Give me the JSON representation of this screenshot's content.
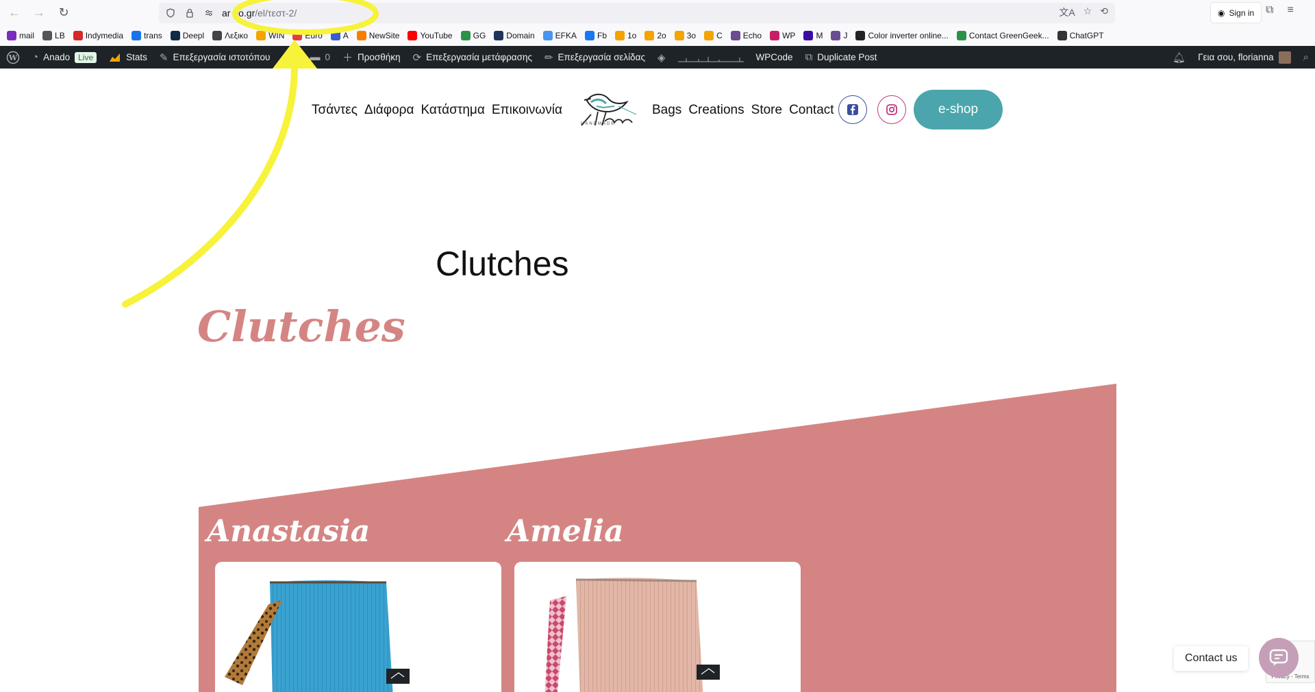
{
  "browser": {
    "url_host": "ar  do.gr",
    "url_path": "/el/τεστ-2/",
    "signin_label": "Sign in"
  },
  "bookmarks": [
    {
      "label": "mail",
      "icon": "mail-icon",
      "color": "#7b2cbf"
    },
    {
      "label": "LB",
      "icon": "lb-icon",
      "color": "#555555"
    },
    {
      "label": "Indymedia",
      "icon": "indymedia-icon",
      "color": "#d62828"
    },
    {
      "label": "trans",
      "icon": "translate-icon",
      "color": "#1a73e8"
    },
    {
      "label": "Deepl",
      "icon": "deepl-icon",
      "color": "#0f2b46"
    },
    {
      "label": "Λεξικο",
      "icon": "dictionary-icon",
      "color": "#444444"
    },
    {
      "label": "WIN",
      "icon": "win-icon",
      "color": "#f4a300"
    },
    {
      "label": "Euro",
      "icon": "euro-icon",
      "color": "#e63946"
    },
    {
      "label": "A",
      "icon": "a-icon",
      "color": "#3a5ccc"
    },
    {
      "label": "NewSite",
      "icon": "newsite-icon",
      "color": "#f77f00"
    },
    {
      "label": "YouTube",
      "icon": "youtube-icon",
      "color": "#ff0000"
    },
    {
      "label": "GG",
      "icon": "gg-icon",
      "color": "#2b9348"
    },
    {
      "label": "Domain",
      "icon": "domain-icon",
      "color": "#1d3557"
    },
    {
      "label": "EFKA",
      "icon": "efka-icon",
      "color": "#4895ef"
    },
    {
      "label": "Fb",
      "icon": "facebook-icon",
      "color": "#1877f2"
    },
    {
      "label": "1o",
      "icon": "rss-icon",
      "color": "#f4a300"
    },
    {
      "label": "2o",
      "icon": "rss-icon",
      "color": "#f4a300"
    },
    {
      "label": "3o",
      "icon": "rss-icon",
      "color": "#f4a300"
    },
    {
      "label": "C",
      "icon": "rss-icon",
      "color": "#f4a300"
    },
    {
      "label": "Echo",
      "icon": "echo-icon",
      "color": "#6a4c93"
    },
    {
      "label": "WP",
      "icon": "wp-icon",
      "color": "#c71f66"
    },
    {
      "label": "M",
      "icon": "m-icon",
      "color": "#3a0ca3"
    },
    {
      "label": "J",
      "icon": "j-icon",
      "color": "#6a4c93"
    },
    {
      "label": "Color inverter online...",
      "icon": "color-inverter-icon",
      "color": "#222222"
    },
    {
      "label": "Contact GreenGeek...",
      "icon": "greengeek-icon",
      "color": "#2b9348"
    },
    {
      "label": "ChatGPT",
      "icon": "chatgpt-icon",
      "color": "#333333"
    }
  ],
  "adminbar": {
    "site": "Anado",
    "live": "Live",
    "stats": "Stats",
    "edit_site": "Επεξεργασία ιστοτόπου",
    "comments": "0",
    "add": "Προσθήκη",
    "edit_translation": "Επεξεργασία μετάφρασης",
    "edit_page": "Επεξεργασία σελίδας",
    "wpcode": "WPCode",
    "duplicate": "Duplicate Post",
    "greeting": "Γεια σου, florianna"
  },
  "header": {
    "menu_el": [
      "Τσάντες",
      "Διάφορα",
      "Κατάστημα",
      "Επικοινωνία"
    ],
    "logo_sub": "HANDMADE",
    "menu_en": [
      "Bags",
      "Creations",
      "Store",
      "Contact"
    ],
    "eshop": "e-shop"
  },
  "page": {
    "title": "Clutches",
    "script_title": "Clutches",
    "products": [
      {
        "name": "Anastasia",
        "color": "#3aa2d0"
      },
      {
        "name": "Amelia",
        "color": "#e2b7a7"
      }
    ]
  },
  "contact_us": "Contact us",
  "recaptcha": "Privacy - Terms",
  "colors": {
    "pink": "#d48583",
    "teal": "#4aa6ac",
    "highlight": "#f7f23a",
    "adminbar": "#1d2327"
  }
}
